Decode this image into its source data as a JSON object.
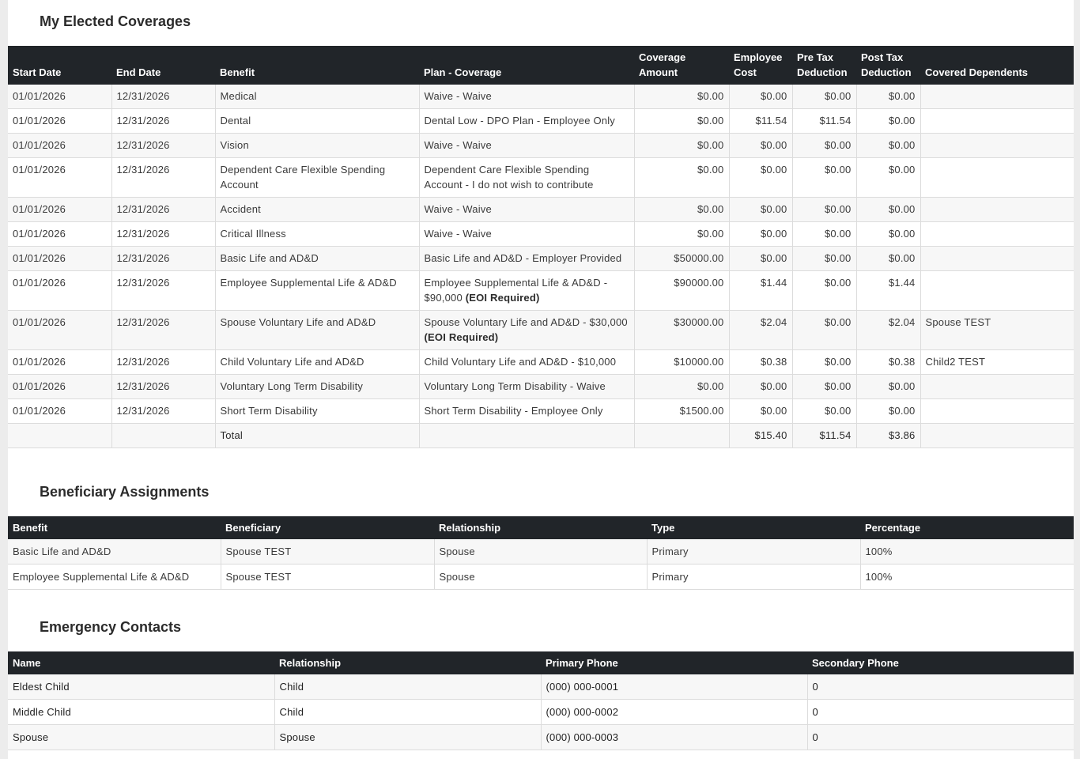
{
  "coverages": {
    "title": "My Elected Coverages",
    "headers": {
      "start_date": "Start Date",
      "end_date": "End Date",
      "benefit": "Benefit",
      "plan_coverage": "Plan - Coverage",
      "coverage_amount": "Coverage Amount",
      "employee_cost_1": "Employee",
      "employee_cost_2": "Cost",
      "pre_tax_1": "Pre Tax",
      "pre_tax_2": "Deduction",
      "post_tax_1": "Post Tax",
      "post_tax_2": "Deduction",
      "covered_dependents": "Covered Dependents"
    },
    "rows": [
      {
        "start": "01/01/2026",
        "end": "12/31/2026",
        "benefit": "Medical",
        "plan": "Waive - Waive",
        "plan_note": "",
        "amount": "$0.00",
        "emp_cost": "$0.00",
        "pre_tax": "$0.00",
        "post_tax": "$0.00",
        "dependents": ""
      },
      {
        "start": "01/01/2026",
        "end": "12/31/2026",
        "benefit": "Dental",
        "plan": "Dental Low - DPO Plan - Employee Only",
        "plan_note": "",
        "amount": "$0.00",
        "emp_cost": "$11.54",
        "pre_tax": "$11.54",
        "post_tax": "$0.00",
        "dependents": ""
      },
      {
        "start": "01/01/2026",
        "end": "12/31/2026",
        "benefit": "Vision",
        "plan": "Waive - Waive",
        "plan_note": "",
        "amount": "$0.00",
        "emp_cost": "$0.00",
        "pre_tax": "$0.00",
        "post_tax": "$0.00",
        "dependents": ""
      },
      {
        "start": "01/01/2026",
        "end": "12/31/2026",
        "benefit": "Dependent Care Flexible Spending Account",
        "plan": "Dependent Care Flexible Spending Account - I do not wish to contribute",
        "plan_note": "",
        "amount": "$0.00",
        "emp_cost": "$0.00",
        "pre_tax": "$0.00",
        "post_tax": "$0.00",
        "dependents": ""
      },
      {
        "start": "01/01/2026",
        "end": "12/31/2026",
        "benefit": "Accident",
        "plan": "Waive - Waive",
        "plan_note": "",
        "amount": "$0.00",
        "emp_cost": "$0.00",
        "pre_tax": "$0.00",
        "post_tax": "$0.00",
        "dependents": ""
      },
      {
        "start": "01/01/2026",
        "end": "12/31/2026",
        "benefit": "Critical Illness",
        "plan": "Waive - Waive",
        "plan_note": "",
        "amount": "$0.00",
        "emp_cost": "$0.00",
        "pre_tax": "$0.00",
        "post_tax": "$0.00",
        "dependents": ""
      },
      {
        "start": "01/01/2026",
        "end": "12/31/2026",
        "benefit": "Basic Life and AD&D",
        "plan": "Basic Life and AD&D - Employer Provided",
        "plan_note": "",
        "amount": "$50000.00",
        "emp_cost": "$0.00",
        "pre_tax": "$0.00",
        "post_tax": "$0.00",
        "dependents": ""
      },
      {
        "start": "01/01/2026",
        "end": "12/31/2026",
        "benefit": "Employee Supplemental Life & AD&D",
        "plan": "Employee Supplemental Life & AD&D - $90,000 ",
        "plan_note": "(EOI Required)",
        "amount": "$90000.00",
        "emp_cost": "$1.44",
        "pre_tax": "$0.00",
        "post_tax": "$1.44",
        "dependents": ""
      },
      {
        "start": "01/01/2026",
        "end": "12/31/2026",
        "benefit": "Spouse Voluntary Life and AD&D",
        "plan": "Spouse Voluntary Life and AD&D - $30,000 ",
        "plan_note": "(EOI Required)",
        "amount": "$30000.00",
        "emp_cost": "$2.04",
        "pre_tax": "$0.00",
        "post_tax": "$2.04",
        "dependents": "Spouse TEST"
      },
      {
        "start": "01/01/2026",
        "end": "12/31/2026",
        "benefit": "Child Voluntary Life and AD&D",
        "plan": "Child Voluntary Life and AD&D - $10,000",
        "plan_note": "",
        "amount": "$10000.00",
        "emp_cost": "$0.38",
        "pre_tax": "$0.00",
        "post_tax": "$0.38",
        "dependents": "Child2 TEST"
      },
      {
        "start": "01/01/2026",
        "end": "12/31/2026",
        "benefit": "Voluntary Long Term Disability",
        "plan": "Voluntary Long Term Disability - Waive",
        "plan_note": "",
        "amount": "$0.00",
        "emp_cost": "$0.00",
        "pre_tax": "$0.00",
        "post_tax": "$0.00",
        "dependents": ""
      },
      {
        "start": "01/01/2026",
        "end": "12/31/2026",
        "benefit": "Short Term Disability",
        "plan": "Short Term Disability - Employee Only",
        "plan_note": "",
        "amount": "$1500.00",
        "emp_cost": "$0.00",
        "pre_tax": "$0.00",
        "post_tax": "$0.00",
        "dependents": ""
      }
    ],
    "total": {
      "label": "Total",
      "emp_cost": "$15.40",
      "pre_tax": "$11.54",
      "post_tax": "$3.86"
    }
  },
  "beneficiaries": {
    "title": "Beneficiary Assignments",
    "headers": [
      "Benefit",
      "Beneficiary",
      "Relationship",
      "Type",
      "Percentage"
    ],
    "rows": [
      [
        "Basic Life and AD&D",
        "Spouse TEST",
        "Spouse",
        "Primary",
        "100%"
      ],
      [
        "Employee Supplemental Life & AD&D",
        "Spouse TEST",
        "Spouse",
        "Primary",
        "100%"
      ]
    ]
  },
  "emergency": {
    "title": "Emergency Contacts",
    "headers": [
      "Name",
      "Relationship",
      "Primary Phone",
      "Secondary Phone"
    ],
    "rows": [
      [
        "Eldest Child",
        "Child",
        "(000) 000-0001",
        "0"
      ],
      [
        "Middle Child",
        "Child",
        "(000) 000-0002",
        "0"
      ],
      [
        "Spouse",
        "Spouse",
        "(000) 000-0003",
        "0"
      ]
    ]
  }
}
